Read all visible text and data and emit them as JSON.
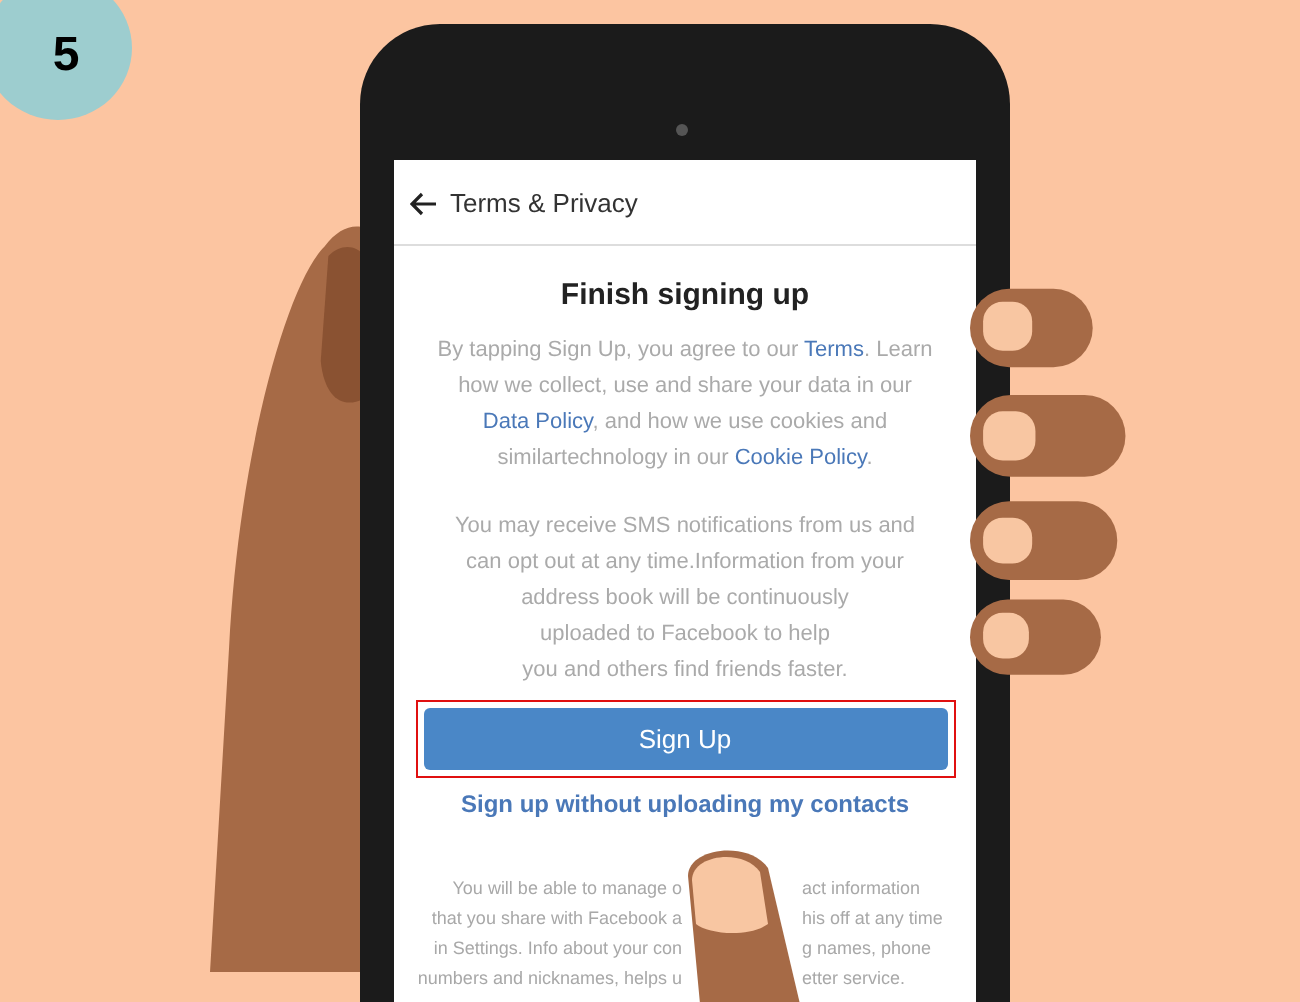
{
  "badge": "5",
  "header": {
    "title": "Terms & Privacy"
  },
  "heading": "Finish signing up",
  "terms_segments": [
    {
      "kind": "plain",
      "text": "By tapping Sign Up, you agree to our "
    },
    {
      "kind": "link",
      "text": "Terms"
    },
    {
      "kind": "plain",
      "text": ". Learn how we collect, use and share your data in our "
    },
    {
      "kind": "link",
      "text": "Data Policy"
    },
    {
      "kind": "plain",
      "text": ", and how we use cookies and similartechnology in our "
    },
    {
      "kind": "link",
      "text": "Cookie Policy"
    },
    {
      "kind": "plain",
      "text": "."
    }
  ],
  "sms_lines": [
    "You may receive SMS notifications from us and",
    "can opt out at any time.Information from your",
    "address book will be continuously",
    "uploaded to Facebook to help",
    "you and others find friends faster."
  ],
  "primary_button": {
    "label": "Sign Up",
    "highlighted": true
  },
  "secondary_link": "Sign up without uploading my contacts",
  "covered_lines": [
    {
      "left": "You will be able to manage o",
      "right": "act information"
    },
    {
      "left": "that you share with Facebook a",
      "right": "his off at any time"
    },
    {
      "left": "in Settings. Info about your con",
      "right": "g names, phone"
    },
    {
      "left": "numbers and nicknames, helps u",
      "right": "etter service."
    }
  ]
}
